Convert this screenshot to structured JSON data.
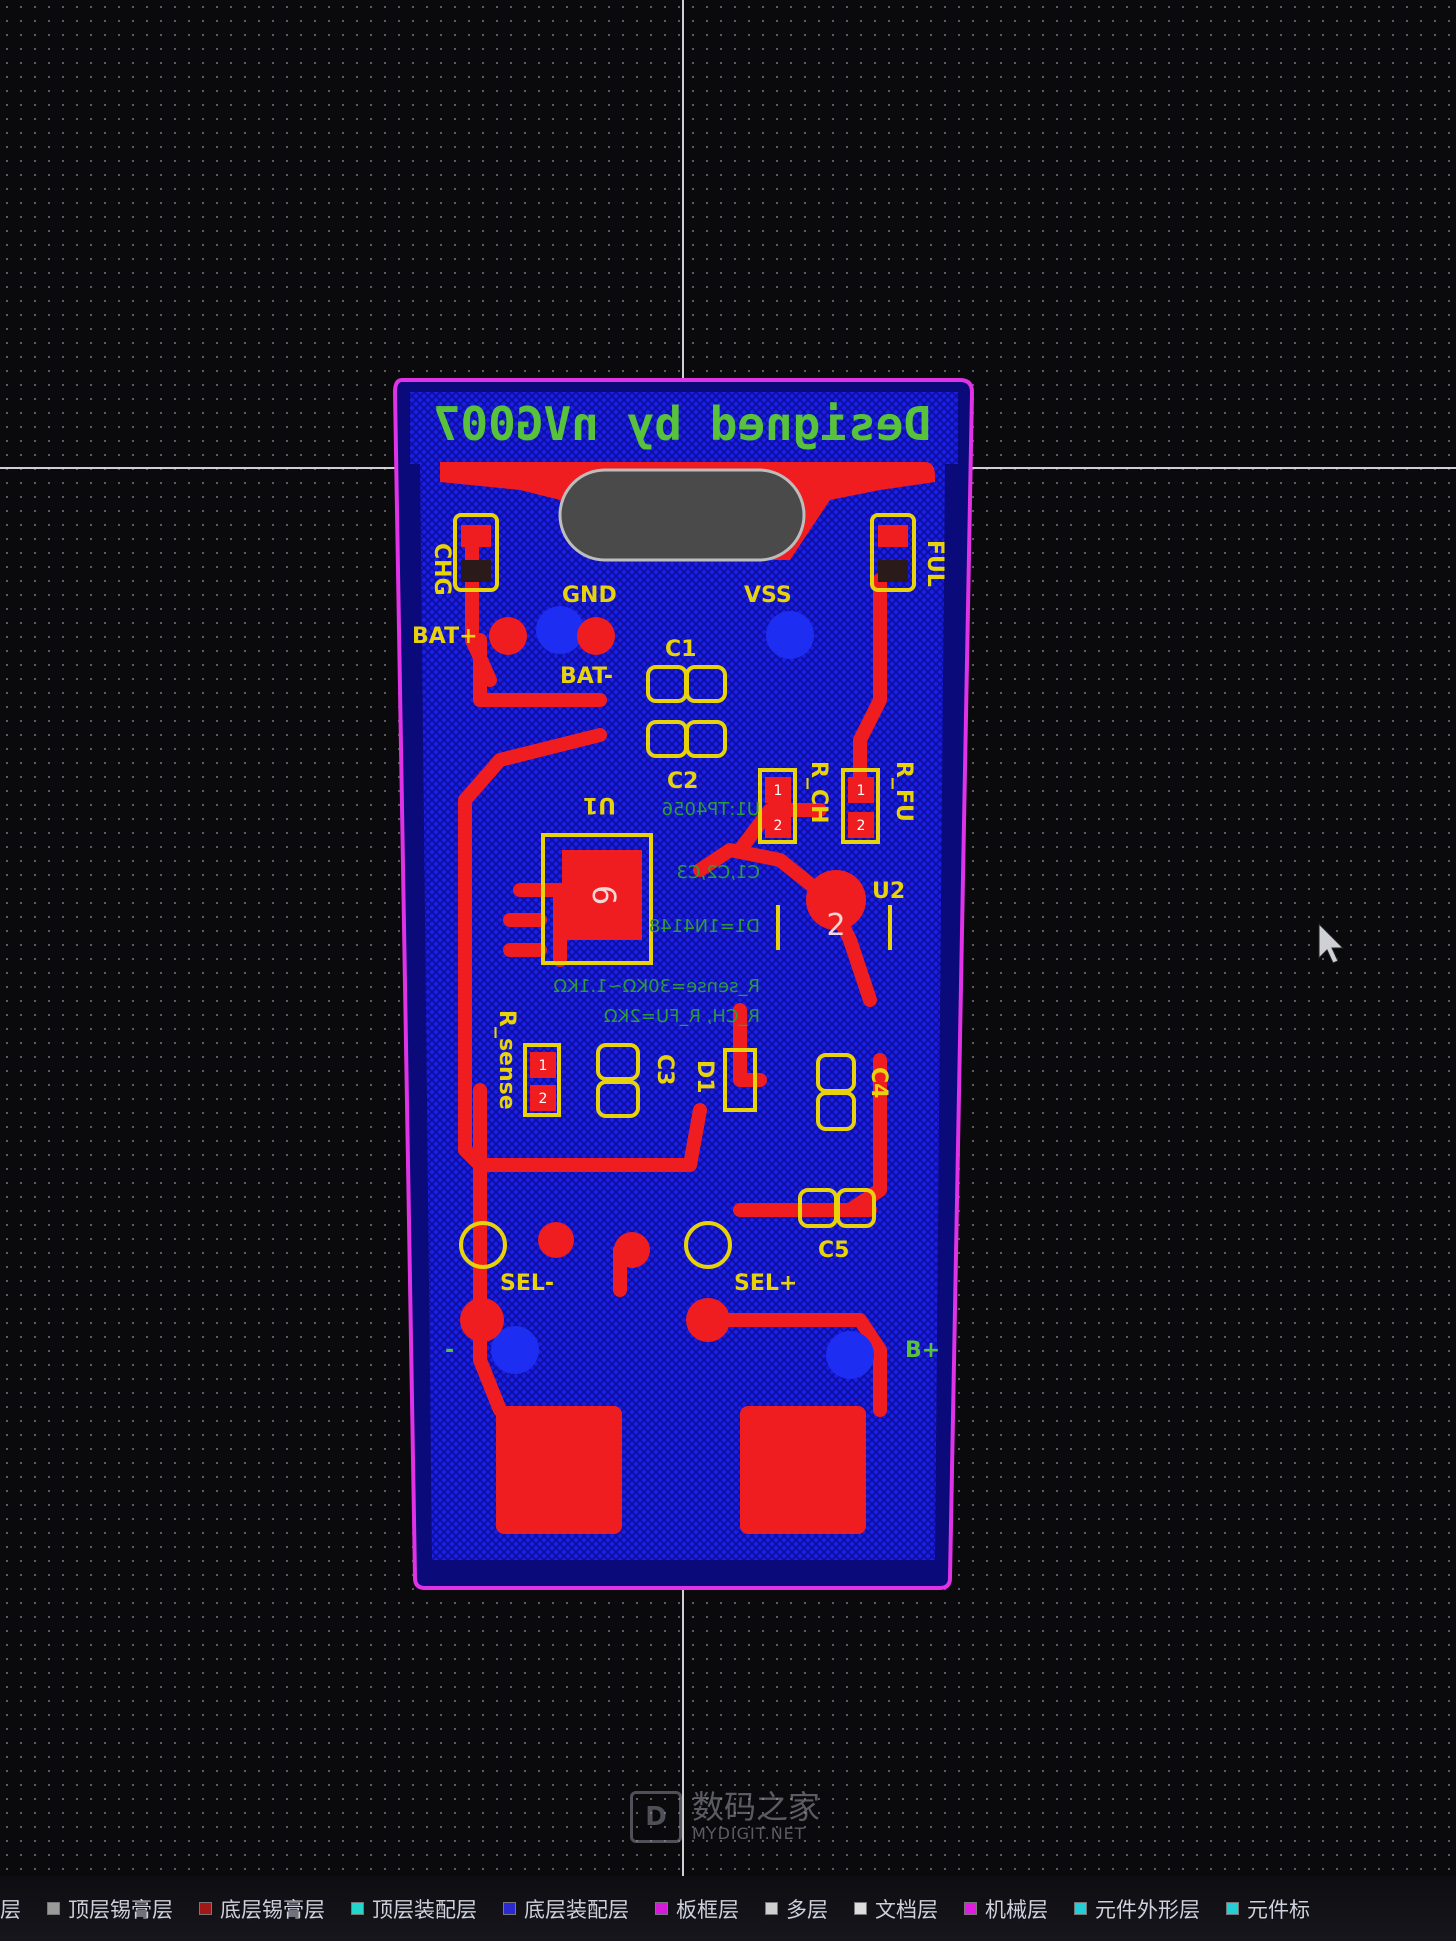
{
  "board": {
    "title_text": "Designed by nVG007",
    "silkscreen_labels": {
      "chg": "CHG",
      "ful": "FUL",
      "gnd": "GND",
      "vss": "VSS",
      "bat_plus": "BAT+",
      "bat_minus": "BAT-",
      "c1": "C1",
      "c2": "C2",
      "c3": "C3",
      "c4": "C4",
      "c5": "C5",
      "u1": "U1",
      "u2": "U2",
      "d1": "D1",
      "r_ch": "R_CH",
      "r_fu": "R_FU",
      "r_sense": "R_sense",
      "sel_minus": "SEL-",
      "sel_plus": "SEL+",
      "b_plus": "B+",
      "minus": "-",
      "pad_1": "1",
      "pad_2": "2",
      "pad_6": "6",
      "u2_pad": "2"
    },
    "notes": [
      "U1:TP4056",
      "C1,C2,C3",
      "D1=1N4148",
      "R_sense=30KΩ~1.1KΩ",
      "R_CH, R_FU=2KΩ"
    ],
    "colors": {
      "background": "#0a090c",
      "grid_dot": "#5a5a66",
      "board_outline": "#e033e6",
      "bottom_copper": "#1a1ee6",
      "top_copper": "#ef1d20",
      "silkscreen": "#e8d20a",
      "title_green": "#58c23a",
      "keepout": "#8a8a8a"
    }
  },
  "layer_tabs": [
    {
      "label": "层",
      "color": "#ffffff",
      "show_swatch": false
    },
    {
      "label": "顶层锡膏层",
      "color": "#9a9a9a",
      "show_swatch": true
    },
    {
      "label": "底层锡膏层",
      "color": "#a01818",
      "show_swatch": true
    },
    {
      "label": "顶层装配层",
      "color": "#22d6cc",
      "show_swatch": true
    },
    {
      "label": "底层装配层",
      "color": "#2a2ad0",
      "show_swatch": true
    },
    {
      "label": "板框层",
      "color": "#d41cd8",
      "show_swatch": true
    },
    {
      "label": "多层",
      "color": "#cfcfcf",
      "show_swatch": true
    },
    {
      "label": "文档层",
      "color": "#dddddd",
      "show_swatch": true
    },
    {
      "label": "机械层",
      "color": "#e01ce0",
      "show_swatch": true
    },
    {
      "label": "元件外形层",
      "color": "#22cfd6",
      "show_swatch": true
    },
    {
      "label": "元件标",
      "color": "#22cfd6",
      "show_swatch": true
    }
  ],
  "watermark": {
    "brand_cn": "数码之家",
    "brand_en": "MYDIGIT.NET",
    "logo_letter": "D"
  }
}
